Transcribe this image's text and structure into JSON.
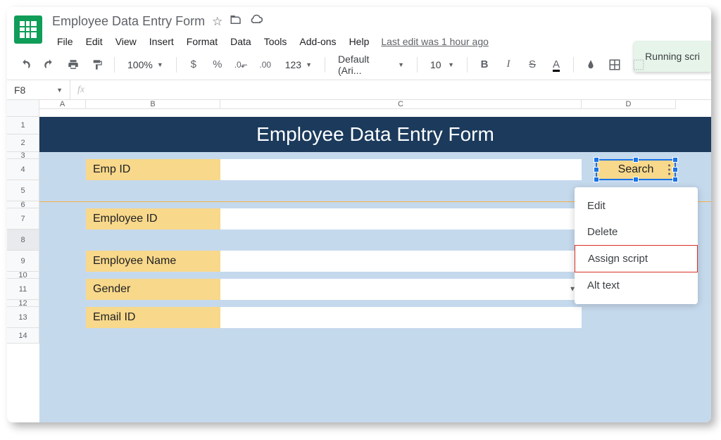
{
  "document": {
    "title": "Employee Data Entry Form",
    "last_edit": "Last edit was 1 hour ago"
  },
  "menus": [
    "File",
    "Edit",
    "View",
    "Insert",
    "Format",
    "Data",
    "Tools",
    "Add-ons",
    "Help"
  ],
  "toolbar": {
    "zoom": "100%",
    "currency": "$",
    "percent": "%",
    "dec_remove": ".0̷",
    "dec_add": ".00̷",
    "format_123": "123",
    "font": "Default (Ari...",
    "font_size": "10"
  },
  "name_box": {
    "ref": "F8",
    "fx": "fx"
  },
  "toast": {
    "text": "Running scri"
  },
  "columns": [
    "A",
    "B",
    "C",
    "D"
  ],
  "rows": [
    "1",
    "2",
    "3",
    "4",
    "5",
    "6",
    "7",
    "8",
    "9",
    "10",
    "11",
    "12",
    "13",
    "14"
  ],
  "form": {
    "title": "Employee Data Entry Form",
    "fields": {
      "emp_id": "Emp ID",
      "employee_id": "Employee ID",
      "employee_name": "Employee Name",
      "gender": "Gender",
      "email_id": "Email ID"
    },
    "search_button": "Search"
  },
  "context_menu": {
    "edit": "Edit",
    "delete": "Delete",
    "assign_script": "Assign script",
    "alt_text": "Alt text"
  }
}
